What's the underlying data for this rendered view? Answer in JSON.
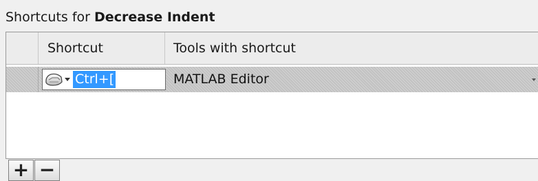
{
  "title": {
    "prefix": "Shortcuts for ",
    "command": "Decrease Indent"
  },
  "table": {
    "columns": [
      "Shortcut",
      "Tools with shortcut"
    ],
    "rows": [
      {
        "shortcut": "Ctrl+[",
        "tool": "MATLAB Editor",
        "icon": "keyboard-icon",
        "selected": true
      }
    ]
  },
  "buttons": {
    "add_label": "+",
    "remove_label": "−"
  },
  "colors": {
    "selection_highlight": "#3399ff",
    "selected_row": "#c2c2c2"
  }
}
